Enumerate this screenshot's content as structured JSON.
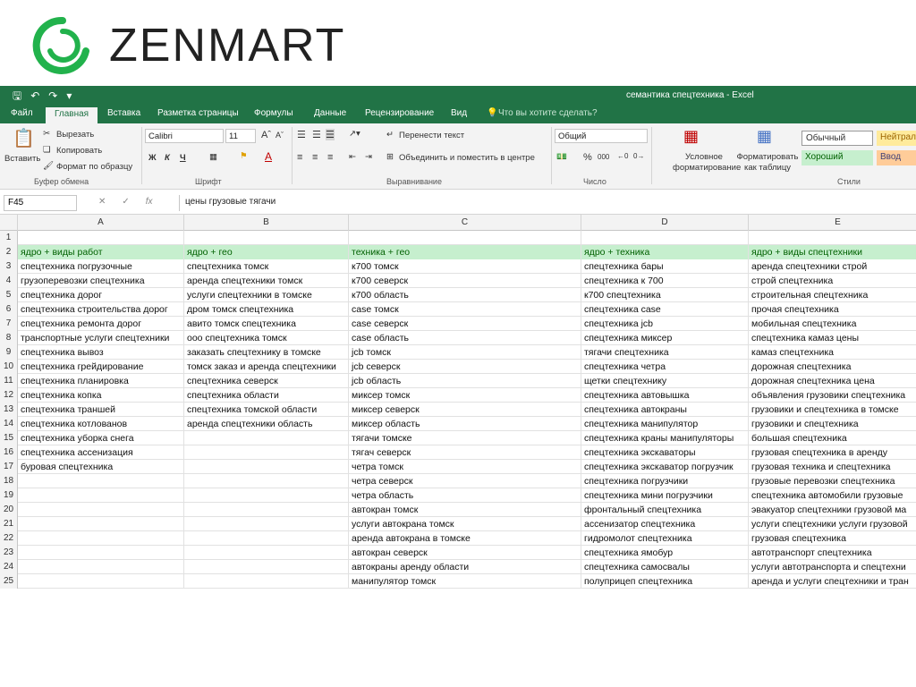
{
  "logo": {
    "text": "ZENMART",
    "color": "#22b24c"
  },
  "window": {
    "title": "семантика спецтехника - Excel",
    "accent": "#217346"
  },
  "tabs": [
    "Файл",
    "Главная",
    "Вставка",
    "Разметка страницы",
    "Формулы",
    "Данные",
    "Рецензирование",
    "Вид",
    "Что вы хотите сделать?"
  ],
  "ribbon": {
    "clipboard": {
      "paste": "Вставить",
      "cut": "Вырезать",
      "copy": "Копировать",
      "format_painter": "Формат по образцу",
      "label": "Буфер обмена"
    },
    "font": {
      "name": "Calibri",
      "size": "11",
      "bold": "Ж",
      "italic": "К",
      "underline": "Ч",
      "label": "Шрифт"
    },
    "alignment": {
      "wrap": "Перенести текст",
      "merge": "Объединить и поместить в центре",
      "label": "Выравнивание"
    },
    "number": {
      "format": "Общий",
      "label": "Число"
    },
    "styles": {
      "conditional": "Условное форматирование",
      "as_table": "Форматировать как таблицу",
      "normal": "Обычный",
      "neutral": "Нейтрал",
      "good": "Хороший",
      "input": "Ввод",
      "label": "Стили"
    }
  },
  "formula_bar": {
    "name_box": "F45",
    "formula": "цены грузовые тягачи"
  },
  "columns": [
    "A",
    "B",
    "C",
    "D",
    "E"
  ],
  "rows": [
    [
      "",
      "",
      "",
      "",
      ""
    ],
    [
      "ядро + виды работ",
      "ядро + гео",
      "техника + гео",
      "ядро + техника",
      "ядро + виды спецтехники"
    ],
    [
      "спецтехника погрузочные",
      "спецтехника томск",
      "к700 томск",
      "спецтехника бары",
      "аренда спецтехники строй"
    ],
    [
      "грузоперевозки спецтехника",
      "аренда спецтехники томск",
      "к700 северск",
      "спецтехника к 700",
      "строй спецтехника"
    ],
    [
      "спецтехника дорог",
      "услуги спецтехники в томске",
      "к700 область",
      "к700 спецтехника",
      "строительная спецтехника"
    ],
    [
      "спецтехника строительства дорог",
      "дром томск спецтехника",
      "case томск",
      "спецтехника case",
      "прочая спецтехника"
    ],
    [
      "спецтехника ремонта дорог",
      "авито томск спецтехника",
      "case северск",
      "спецтехника jcb",
      "мобильная спецтехника"
    ],
    [
      "транспортные услуги спецтехники",
      "ооо спецтехника томск",
      "case область",
      "спецтехника миксер",
      "спецтехника камаз цены"
    ],
    [
      "спецтехника вывоз",
      "заказать спецтехнику в томске",
      "jcb томск",
      "тягачи спецтехника",
      "камаз спецтехника"
    ],
    [
      "спецтехника грейдирование",
      "томск заказ и аренда спецтехники",
      "jcb северск",
      "спецтехника четра",
      "дорожная спецтехника"
    ],
    [
      "спецтехника планировка",
      "спецтехника северск",
      "jcb область",
      "щетки спецтехнику",
      "дорожная спецтехника цена"
    ],
    [
      "спецтехника копка",
      "спецтехника области",
      "миксер томск",
      "спецтехника автовышка",
      "объявления грузовики спецтехника"
    ],
    [
      "спецтехника траншей",
      "спецтехника томской области",
      "миксер северск",
      "спецтехника автокраны",
      "грузовики и спецтехника в томске"
    ],
    [
      "спецтехника котлованов",
      "аренда спецтехники область",
      "миксер область",
      "спецтехника манипулятор",
      "грузовики и спецтехника"
    ],
    [
      "спецтехника уборка снега",
      "",
      "тягачи томске",
      "спецтехника краны манипуляторы",
      "большая спецтехника"
    ],
    [
      "спецтехника ассенизация",
      "",
      "тягач северск",
      "спецтехника экскаваторы",
      "грузовая спецтехника в аренду"
    ],
    [
      "буровая спецтехника",
      "",
      "четра томск",
      "спецтехника экскаватор погрузчик",
      "грузовая техника и спецтехника"
    ],
    [
      "",
      "",
      "четра северск",
      "спецтехника погрузчики",
      "грузовые перевозки спецтехника"
    ],
    [
      "",
      "",
      "четра область",
      "спецтехника мини погрузчики",
      "спецтехника автомобили грузовые"
    ],
    [
      "",
      "",
      "автокран томск",
      "фронтальный спецтехника",
      "эвакуатор спецтехники грузовой ма"
    ],
    [
      "",
      "",
      "услуги автокрана томск",
      "ассенизатор спецтехника",
      "услуги спецтехники услуги грузовой"
    ],
    [
      "",
      "",
      "аренда автокрана в томске",
      "гидромолот спецтехника",
      "грузовая спецтехника"
    ],
    [
      "",
      "",
      "автокран северск",
      "спецтехника ямобур",
      "автотранспорт спецтехника"
    ],
    [
      "",
      "",
      "автокраны аренду области",
      "спецтехника самосвалы",
      "услуги автотранспорта и спецтехни"
    ],
    [
      "",
      "",
      "манипулятор томск",
      "полуприцеп спецтехника",
      "аренда и услуги спецтехники и тран"
    ]
  ]
}
